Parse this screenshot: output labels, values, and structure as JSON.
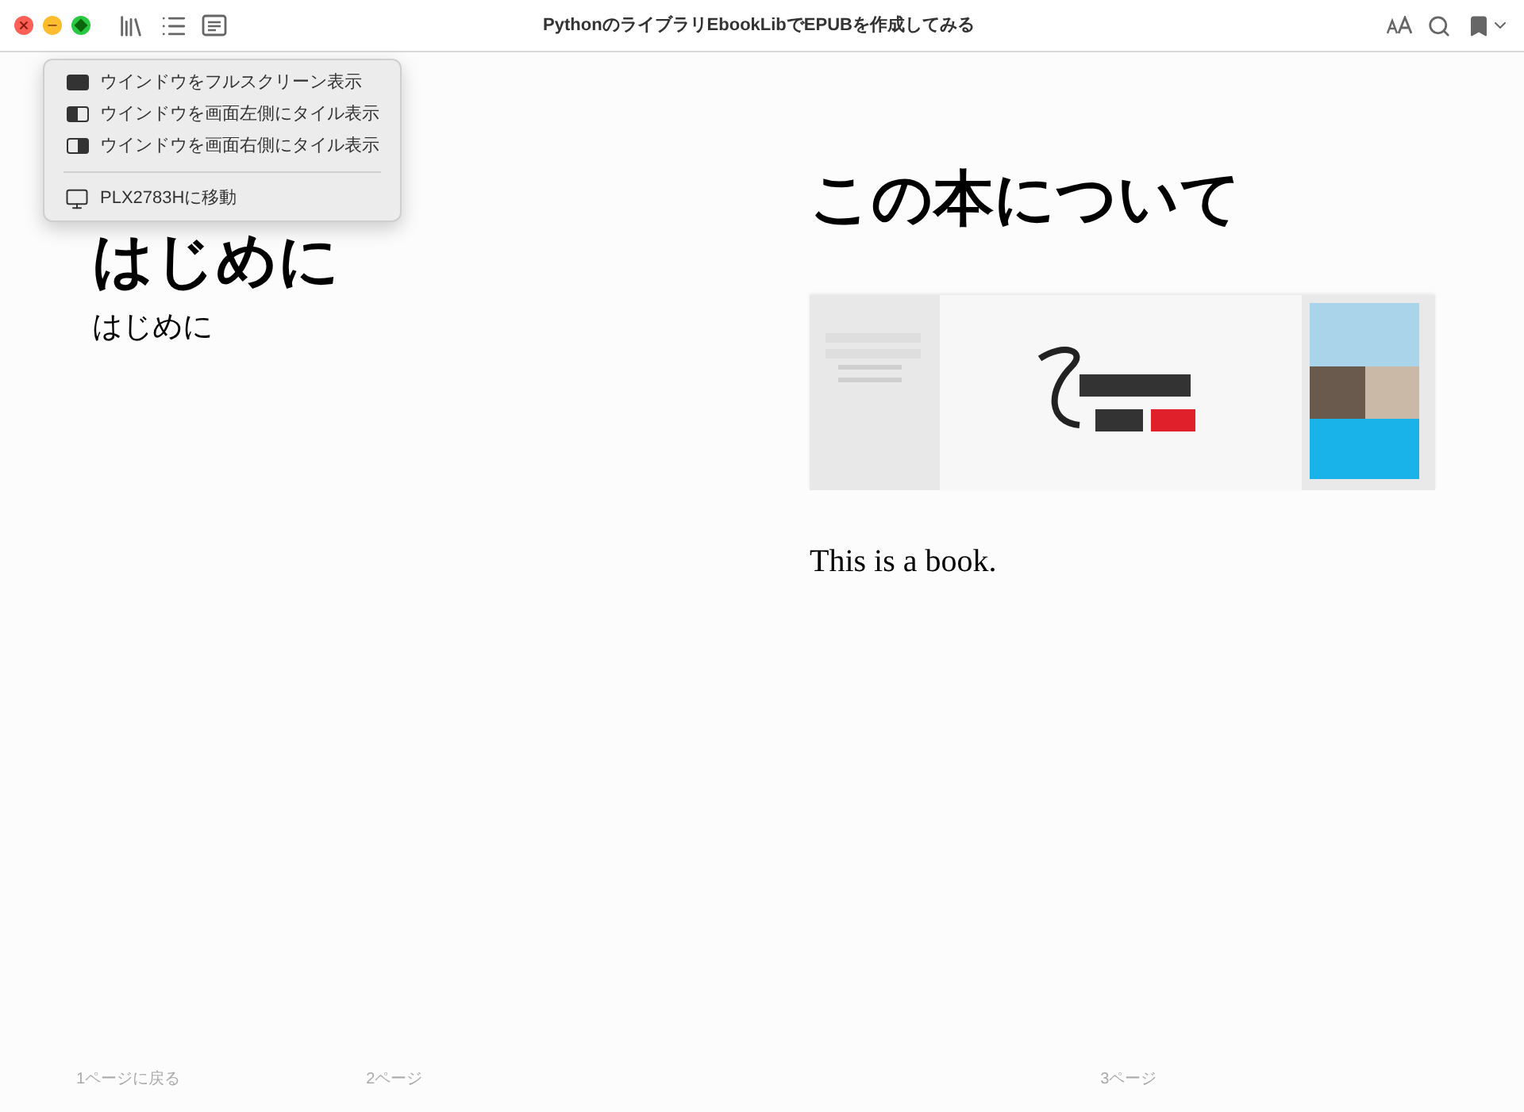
{
  "window": {
    "title": "PythonのライブラリEbookLibでEPUBを作成してみる"
  },
  "window_menu": {
    "items": [
      {
        "kind": "fullscreen",
        "label": "ウインドウをフルスクリーン表示"
      },
      {
        "kind": "tile-left",
        "label": "ウインドウを画面左側にタイル表示"
      },
      {
        "kind": "tile-right",
        "label": "ウインドウを画面右側にタイル表示"
      },
      {
        "kind": "display",
        "label": "PLX2783Hに移動"
      }
    ]
  },
  "left_page": {
    "heading": "はじめに",
    "body": "はじめに"
  },
  "right_page": {
    "heading": "この本について",
    "body": "This is a book."
  },
  "footer": {
    "back": "1ページに戻る",
    "left_page_number": "2ページ",
    "right_page_number": "3ページ"
  }
}
